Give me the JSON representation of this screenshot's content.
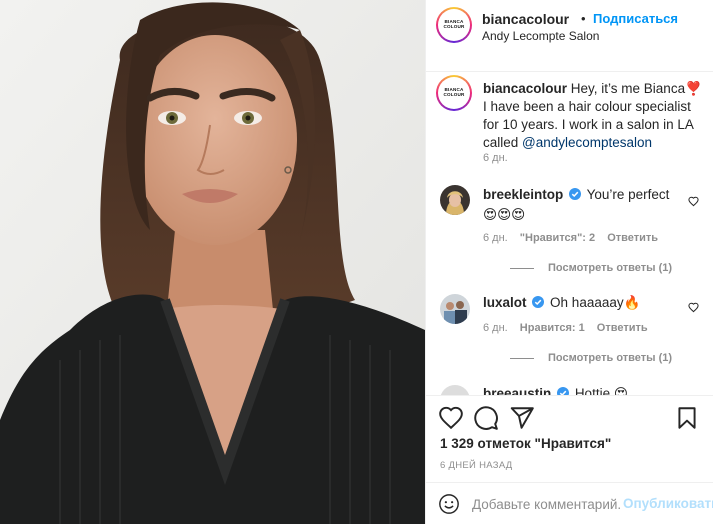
{
  "post": {
    "photo_alt": "",
    "brand_color": "#0095f6",
    "muted_color": "#8e8e8e"
  },
  "header": {
    "username": "biancacolour",
    "dot": "•",
    "follow_label": "Подписаться",
    "location": "Andy Lecompte Salon",
    "avatar_logo": "BIANCA COLOUR"
  },
  "caption": {
    "username": "biancacolour",
    "text": " Hey, it’s me Bianca❣️ I have been a hair colour specialist for 10 years. I work in a salon in LA called ",
    "mention": "@andylecomptesalon",
    "time": "6 дн."
  },
  "comments": [
    {
      "username": "breekleintop",
      "verified": true,
      "text": "You’re perfect 😍😍😍",
      "time": "6 дн.",
      "likes": "\"Нравится\": 2",
      "reply_label": "Ответить",
      "view_replies": "Посмотреть ответы (1)",
      "avatar_icon": "blonde-portrait"
    },
    {
      "username": "luxalot",
      "verified": true,
      "text": "Oh haaaaay🔥",
      "time": "6 дн.",
      "likes": "Нравится: 1",
      "reply_label": "Ответить",
      "view_replies": "Посмотреть ответы (1)",
      "avatar_icon": "group-portrait"
    },
    {
      "username": "breeaustin",
      "verified": true,
      "text": "Hottie 😍",
      "partially_visible": true
    }
  ],
  "actions": {
    "icons": [
      "heart-icon",
      "comment-icon",
      "share-icon",
      "bookmark-icon"
    ],
    "likes_text": "1 329 отметок \"Нравится\"",
    "date_text": "6 ДНЕЙ НАЗАД"
  },
  "composer": {
    "placeholder": "Добавьте комментарий...",
    "publish_label": "Опубликовать"
  }
}
